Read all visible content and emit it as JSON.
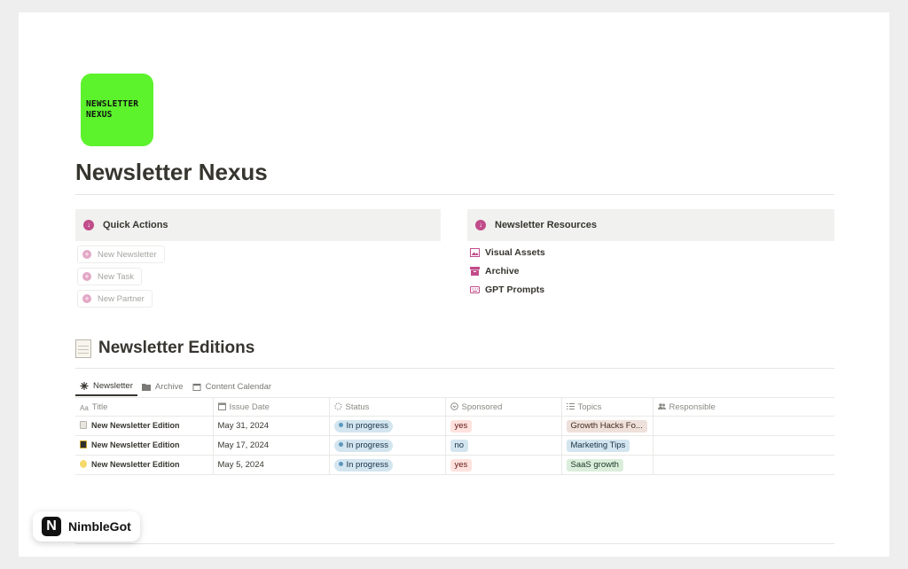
{
  "logo": {
    "line1": "NEWSLETTER",
    "line2": "NEXUS",
    "color": "#5cf22c"
  },
  "page_title": "Newsletter Nexus",
  "quick_actions": {
    "title": "Quick Actions",
    "buttons": [
      {
        "label": "New Newsletter"
      },
      {
        "label": "New Task"
      },
      {
        "label": "New Partner"
      }
    ]
  },
  "resources": {
    "title": "Newsletter Resources",
    "links": [
      {
        "label": "Visual Assets",
        "icon": "image-icon"
      },
      {
        "label": "Archive",
        "icon": "archive-box-icon"
      },
      {
        "label": "GPT Prompts",
        "icon": "keyboard-icon"
      }
    ]
  },
  "editions": {
    "title": "Newsletter Editions",
    "views": [
      {
        "label": "Newsletter",
        "icon": "asterisk-icon"
      },
      {
        "label": "Archive",
        "icon": "folder-icon"
      },
      {
        "label": "Content Calendar",
        "icon": "calendar-icon"
      }
    ],
    "columns": [
      "Title",
      "Issue Date",
      "Status",
      "Sponsored",
      "Topics",
      "Responsible"
    ],
    "title_col_prefix": "Aa",
    "rows": [
      {
        "title": "New Newsletter Edition",
        "date": "May 31, 2024",
        "status": "In progress",
        "sponsored": "yes",
        "topic": "Growth Hacks Fo...",
        "responsible": ""
      },
      {
        "title": "New Newsletter Edition",
        "date": "May 17, 2024",
        "status": "In progress",
        "sponsored": "no",
        "topic": "Marketing Tips",
        "responsible": ""
      },
      {
        "title": "New Newsletter Edition",
        "date": "May 5, 2024",
        "status": "In progress",
        "sponsored": "yes",
        "topic": "SaaS growth",
        "responsible": ""
      }
    ]
  },
  "branding": {
    "mark": "N",
    "name": "NimbleGot"
  },
  "colors": {
    "accent_pink": "#c14c8a",
    "status_blue": "#5b97bd",
    "logo_green": "#5cf22c"
  }
}
